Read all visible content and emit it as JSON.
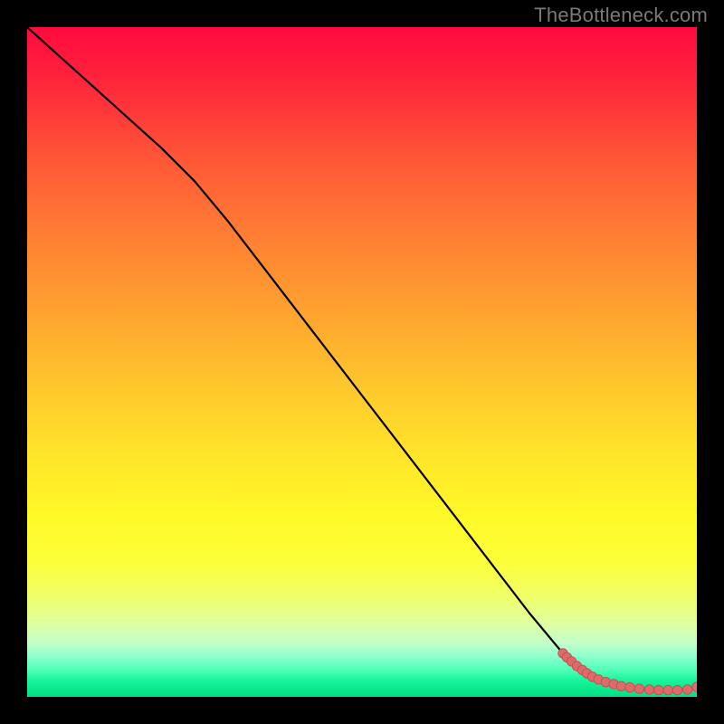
{
  "watermark": "TheBottleneck.com",
  "frame": {
    "black_border_px": 30
  },
  "colors": {
    "background": "#000000",
    "curve": "#000000",
    "marker_fill": "#de6b6b",
    "marker_stroke": "#c94f4f",
    "gradient_top": "#ff0a3e",
    "gradient_bottom": "#04e184",
    "watermark": "#7a7a7a"
  },
  "chart_data": {
    "type": "line",
    "title": "",
    "xlabel": "",
    "ylabel": "",
    "xlim": [
      0,
      100
    ],
    "ylim": [
      0,
      100
    ],
    "grid": false,
    "legend": false,
    "series": [
      {
        "name": "bottleneck-curve",
        "x": [
          0,
          5,
          10,
          15,
          20,
          25,
          30,
          35,
          40,
          45,
          50,
          55,
          60,
          65,
          70,
          75,
          80,
          82,
          84,
          86,
          88,
          90,
          92,
          94,
          96,
          98,
          100
        ],
        "y": [
          100,
          95.5,
          91,
          86.5,
          82,
          77,
          71,
          64.5,
          58,
          51.5,
          45,
          38.5,
          32,
          25.5,
          19,
          12.5,
          6.5,
          4.5,
          3.0,
          2.1,
          1.6,
          1.3,
          1.1,
          1.0,
          1.0,
          1.1,
          1.5
        ]
      }
    ],
    "markers": {
      "name": "dense-sweet-spot",
      "x": [
        80.0,
        80.6,
        81.3,
        82.1,
        82.9,
        83.6,
        84.4,
        85.3,
        86.4,
        87.6,
        88.7,
        90.0,
        91.4,
        92.9,
        94.3,
        95.7,
        97.1,
        98.6,
        100.0
      ],
      "y": [
        6.5,
        5.9,
        5.3,
        4.6,
        4.0,
        3.5,
        3.0,
        2.6,
        2.2,
        1.9,
        1.6,
        1.4,
        1.2,
        1.1,
        1.0,
        1.0,
        1.0,
        1.1,
        1.5
      ]
    }
  }
}
